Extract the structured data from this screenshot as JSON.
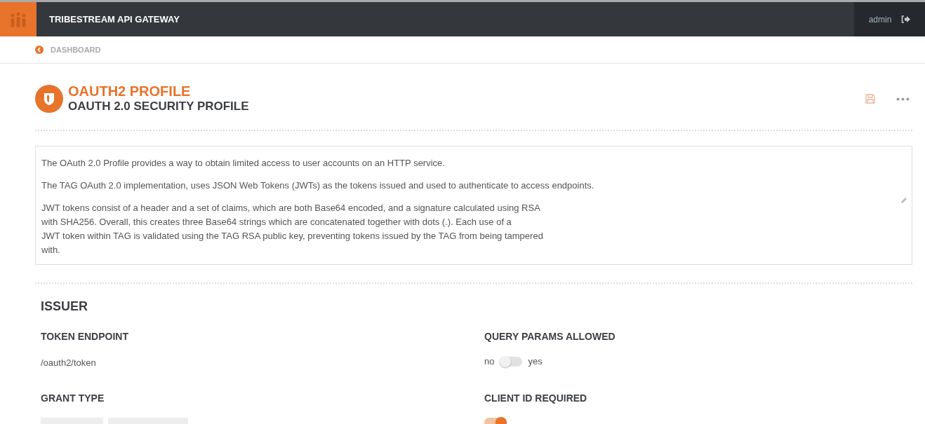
{
  "header": {
    "title": "TRIBESTREAM API GATEWAY",
    "user": "admin"
  },
  "breadcrumb": {
    "label": "DASHBOARD"
  },
  "profile": {
    "title": "OAUTH2 PROFILE",
    "subtitle": "OAUTH 2.0 SECURITY PROFILE"
  },
  "description": [
    "The OAuth 2.0 Profile provides a way to obtain limited access to user accounts on an HTTP service.",
    "The TAG OAuth 2.0 implementation, uses JSON Web Tokens (JWTs) as the tokens issued and used to authenticate to access endpoints.",
    "JWT tokens consist of a header and a set of claims, which are both Base64 encoded, and a signature calculated using RSA\nwith SHA256. Overall, this creates three Base64 strings which are concatenated together with dots (.). Each use of a\nJWT token within TAG is validated using the TAG RSA public key, preventing tokens issued by the TAG from being tampered\nwith."
  ],
  "section": {
    "title": "ISSUER",
    "left": [
      {
        "kind": "text",
        "label": "TOKEN ENDPOINT",
        "value": "/oauth2/token"
      },
      {
        "kind": "chips",
        "label": "GRANT TYPE",
        "chips": [
          {
            "kind": "chip"
          },
          {
            "kind": "chip"
          }
        ]
      }
    ],
    "right": [
      {
        "kind": "toggle",
        "label": "QUERY PARAMS ALLOWED",
        "on": false,
        "off_label": "no",
        "on_label": "yes"
      },
      {
        "kind": "toggle",
        "label": "CLIENT ID REQUIRED",
        "on": true
      }
    ]
  }
}
